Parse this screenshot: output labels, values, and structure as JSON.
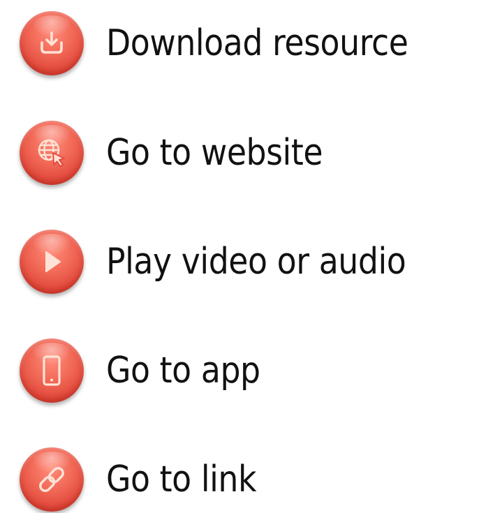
{
  "accent_color": "#ee5a4a",
  "icon_color": "#fde3d6",
  "items": [
    {
      "icon": "download-icon",
      "label": "Download resource"
    },
    {
      "icon": "globe-cursor-icon",
      "label": "Go to website"
    },
    {
      "icon": "play-icon",
      "label": "Play video or audio"
    },
    {
      "icon": "phone-icon",
      "label": "Go to app"
    },
    {
      "icon": "link-icon",
      "label": "Go to link"
    }
  ]
}
